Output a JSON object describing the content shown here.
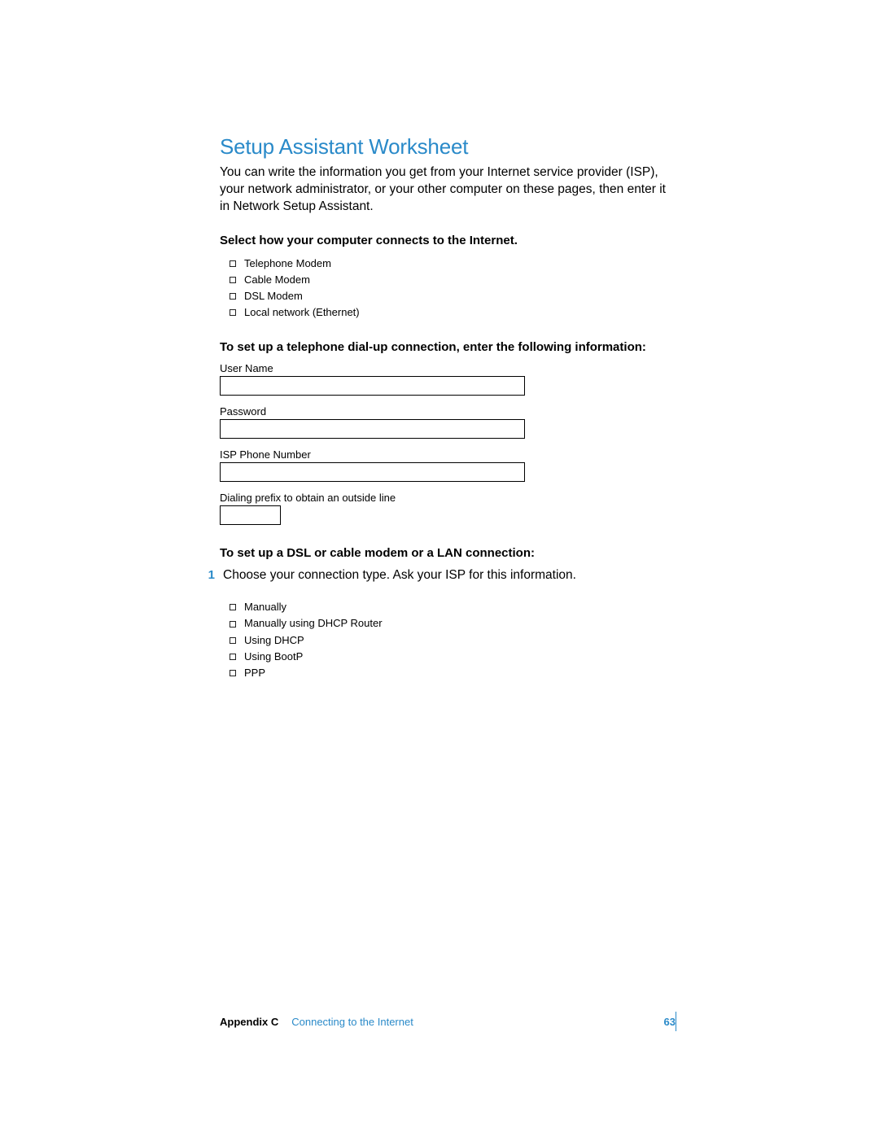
{
  "title": "Setup Assistant Worksheet",
  "intro": "You can write the information you get from your Internet service provider (ISP), your network administrator, or your other computer on these pages, then enter it in Network Setup Assistant.",
  "section1": {
    "heading": "Select how your computer connects to the Internet.",
    "items": [
      "Telephone Modem",
      "Cable Modem",
      "DSL Modem",
      "Local network (Ethernet)"
    ]
  },
  "section2": {
    "heading": "To set up a telephone dial-up connection, enter the following information:",
    "fields": {
      "username": "User Name",
      "password": "Password",
      "isp_phone": "ISP Phone Number",
      "prefix": "Dialing prefix to obtain an outside line"
    }
  },
  "section3": {
    "heading": "To set up a DSL or cable modem or a LAN connection:",
    "step_number": "1",
    "step_text": "Choose your connection type. Ask your ISP for this information.",
    "items": [
      "Manually",
      "Manually using DHCP Router",
      "Using DHCP",
      "Using BootP",
      "PPP"
    ]
  },
  "footer": {
    "appendix": "Appendix C",
    "chapter": "Connecting to the Internet",
    "page": "63"
  }
}
